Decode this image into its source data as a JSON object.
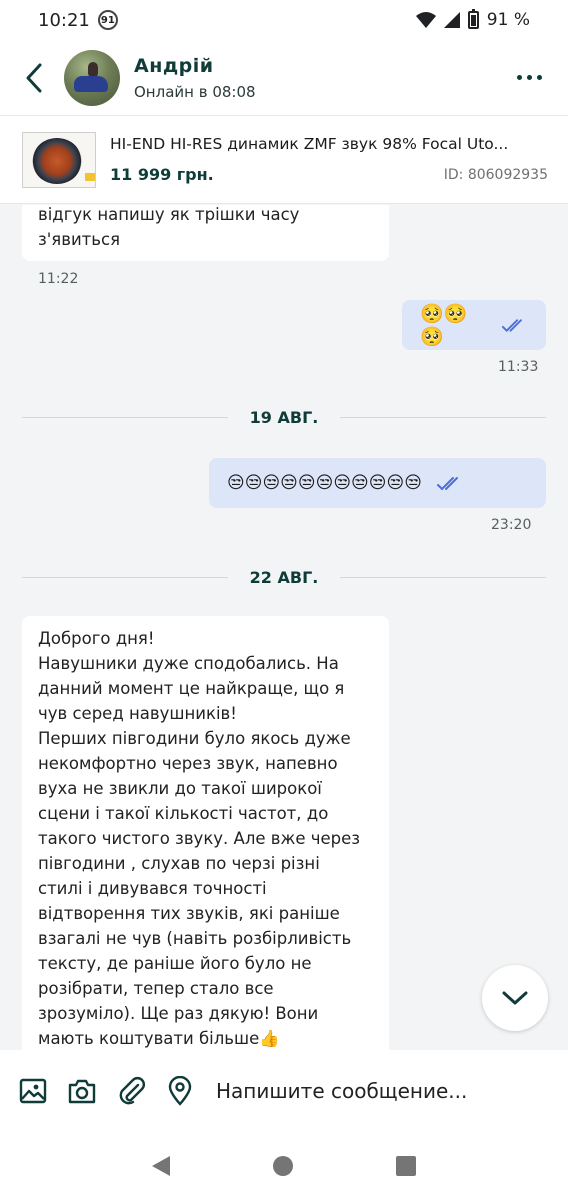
{
  "status_bar": {
    "time": "10:21",
    "notification_count": "91",
    "battery": "91 %"
  },
  "header": {
    "back_icon": "arrow-left-icon",
    "name": "Андрій",
    "status": "Онлайн в 08:08",
    "more_icon": "more-horizontal-icon"
  },
  "product": {
    "title": "HI-END HI-RES динамик ZMF звук 98% Focal Uto...",
    "price": "11 999 грн.",
    "id": "ID: 806092935"
  },
  "messages": [
    {
      "direction": "in",
      "text": "відгук напишу як трішки часу з'явиться",
      "time": "11:22"
    },
    {
      "direction": "out",
      "text": "🥺🥺🥺",
      "time": "11:33",
      "status": "read"
    },
    {
      "type": "date",
      "label": "19 АВГ."
    },
    {
      "direction": "out",
      "text": "😒😒😒😒😒😒😒😒😒😒😒",
      "time": "23:20",
      "status": "read"
    },
    {
      "type": "date",
      "label": "22 АВГ."
    },
    {
      "direction": "in",
      "text": "Доброго дня!\nНавушники дуже сподобались. На данний момент це найкраще, що я чув серед навушників!\nПерших півгодини було якось дуже некомфортно через звук, напевно вуха не звикли до такої широкої сцени і такої кількості частот, до такого чистого звуку. Але вже через півгодини , слухав по черзі різні стилі і дивувався точності відтворення тих звуків, які раніше взагалі не чув (навіть розбірливість тексту, де раніше його було не розібрати, тепер стало все зрозуміло). Ще раз дякую! Вони мають коштувати більше👍"
    }
  ],
  "long_message_lines": [
    "Доброго дня!",
    "Навушники дуже сподобались. На",
    "данний момент це найкраще, що я",
    "чув серед навушників!",
    "Перших півгодини було якось дуже",
    "некомфортно через звук, напевно",
    "вуха не звикли до такої широкої",
    "сцени і такої кількості частот, до",
    "такого чистого звуку. Але вже через",
    "півгодини , слухав по черзі різні",
    "стилі і дивувався точності",
    "відтворення тих звуків, які раніше",
    "взагалі не чув (навіть розбірливість",
    "тексту, де раніше його було не",
    "розібрати, тепер стало все",
    "зрозуміло). Ще раз дякую! Вони",
    "мають коштувати більше👍"
  ],
  "first_message_lines": [
    "відгук напишу як трішки часу",
    "з'явиться"
  ],
  "composer": {
    "placeholder": "Напишите сообщение...",
    "icons": [
      "image-icon",
      "camera-icon",
      "paperclip-icon",
      "location-pin-icon"
    ]
  },
  "scroll_button_icon": "chevron-down-icon",
  "colors": {
    "accent": "#0f3b39",
    "outgoing_bubble": "#dde5f8",
    "incoming_bubble": "#ffffff",
    "background": "#f2f4f5",
    "read_ticks": "#4a6fd8"
  }
}
